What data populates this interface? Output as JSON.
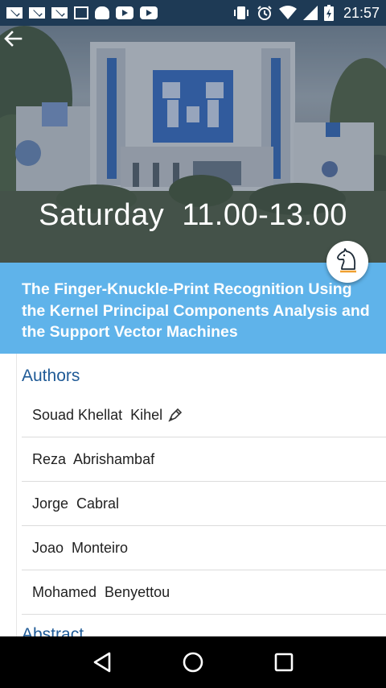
{
  "status_bar": {
    "time": "21:57",
    "notification_icons": [
      "mail-icon",
      "mail-icon",
      "mail-icon",
      "image-icon",
      "android-icon",
      "youtube-icon",
      "youtube-icon"
    ],
    "system_icons": [
      "vibrate-icon",
      "alarm-icon",
      "wifi-icon",
      "signal-icon",
      "battery-icon"
    ]
  },
  "hero": {
    "title": "Saturday  11.00-13.00"
  },
  "paper": {
    "title": "The Finger-Knuckle-Print Recognition Using the Kernel Principal Components Analysis and the Support Vector Machines"
  },
  "authors_section": {
    "heading": "Authors",
    "authors": [
      {
        "name": "Souad Khellat  Kihel",
        "presenter": true
      },
      {
        "name": "Reza  Abrishambaf",
        "presenter": false
      },
      {
        "name": "Jorge  Cabral",
        "presenter": false
      },
      {
        "name": "Joao  Monteiro",
        "presenter": false
      },
      {
        "name": "Mohamed  Benyettou",
        "presenter": false
      }
    ]
  },
  "abstract_section": {
    "heading": "Abstract"
  },
  "colors": {
    "status_bar": "#1e3a55",
    "banner": "#5fb3ea",
    "heading": "#1f5a96",
    "fab_accent": "#f0a030"
  }
}
